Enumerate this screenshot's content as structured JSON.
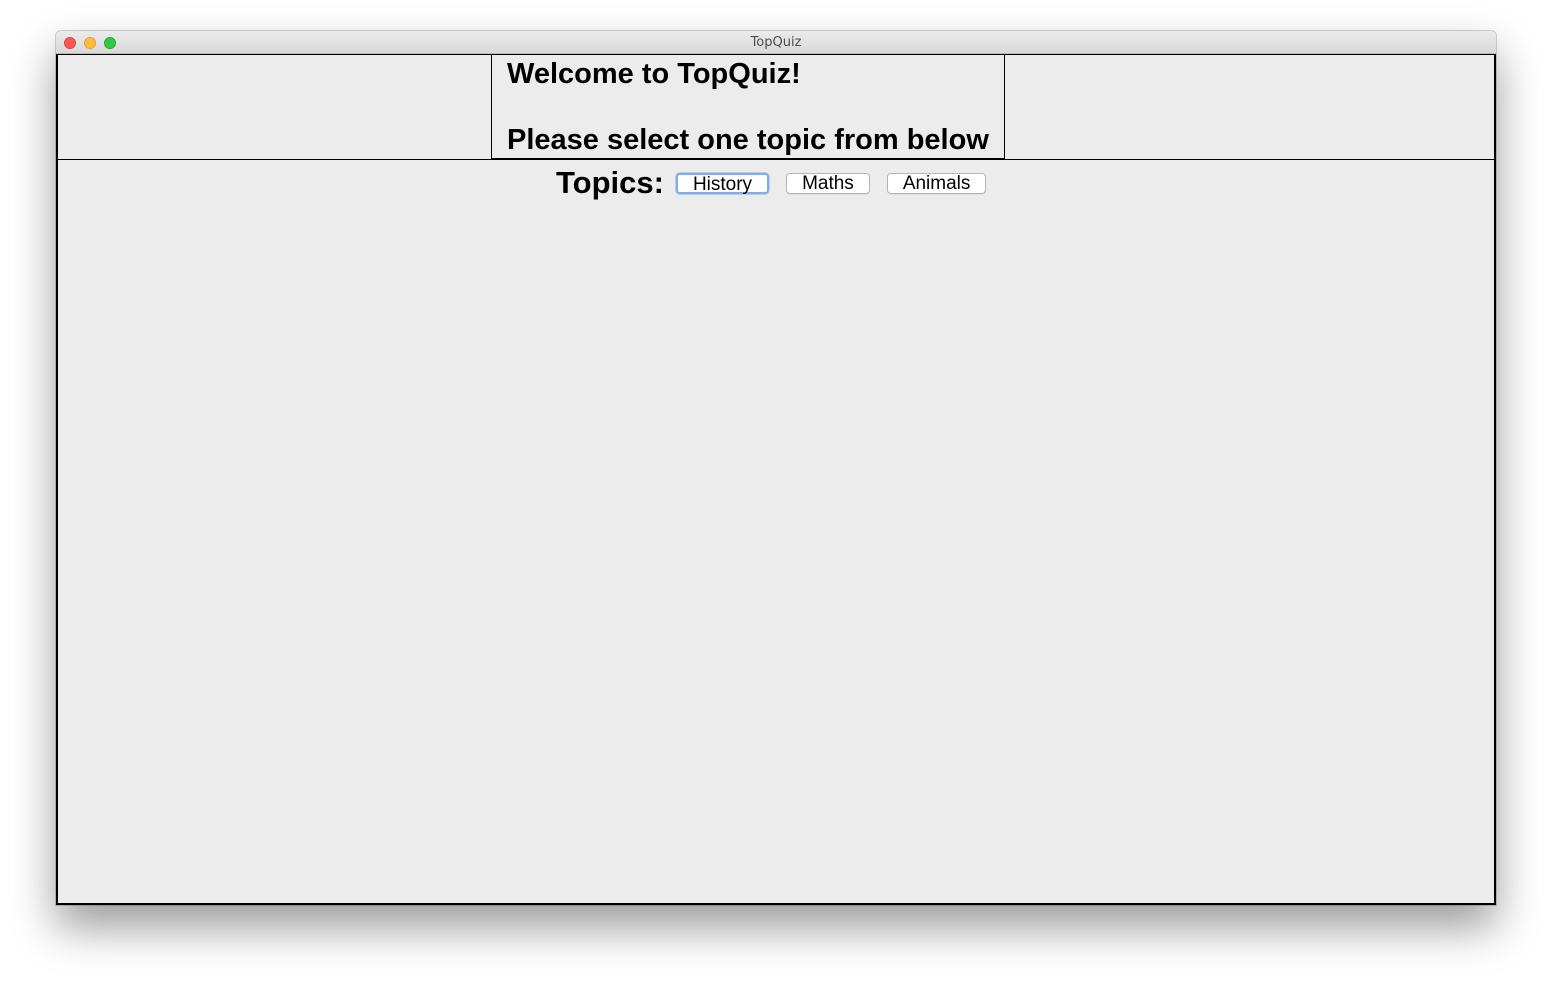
{
  "window": {
    "title": "TopQuiz"
  },
  "header": {
    "welcome": "Welcome to TopQuiz!",
    "instruction": "Please select one topic from below"
  },
  "topics": {
    "label": "Topics:",
    "buttons": [
      {
        "label": "History",
        "focused": true
      },
      {
        "label": "Maths",
        "focused": false
      },
      {
        "label": "Animals",
        "focused": false
      }
    ]
  },
  "colors": {
    "close": "#fc5753",
    "minimize": "#fdbc40",
    "maximize": "#33c748",
    "focus_ring": "#7eaee7",
    "background": "#ececec"
  }
}
